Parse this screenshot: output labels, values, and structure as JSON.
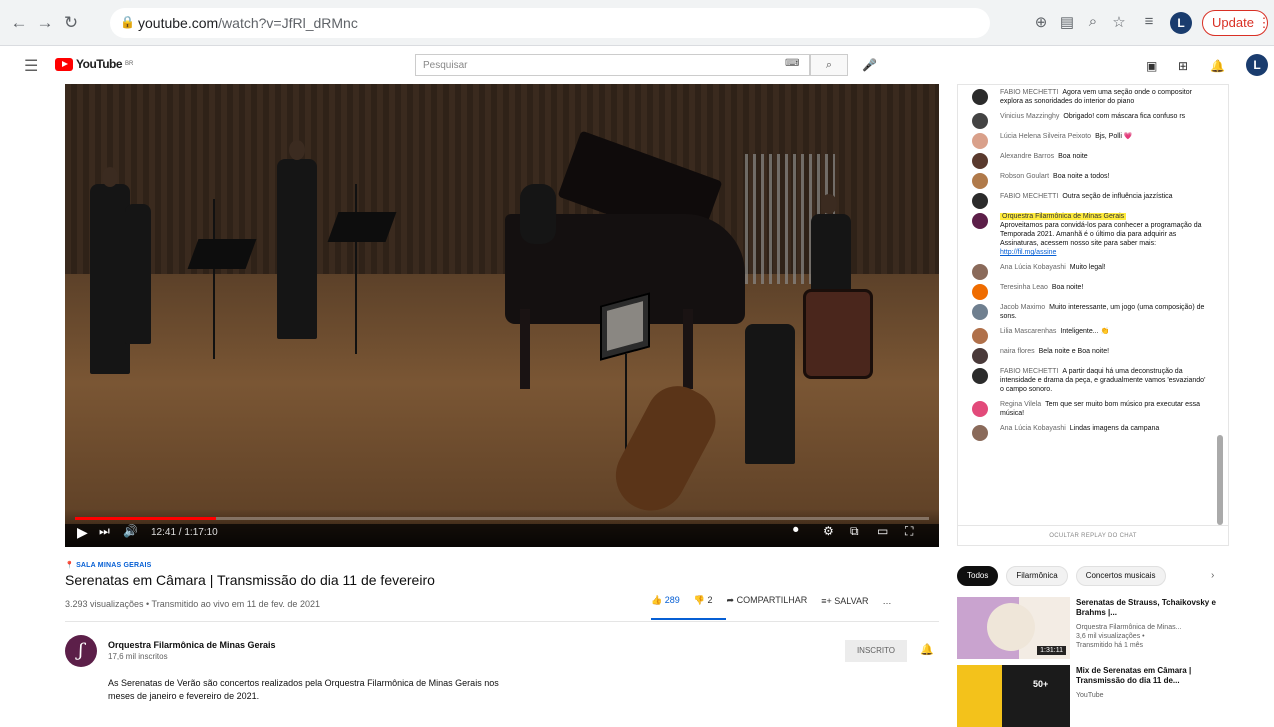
{
  "browser": {
    "url_host": "youtube.com",
    "url_path": "/watch?v=JfRl_dRMnc",
    "update_label": "Update",
    "profile_initial": "L"
  },
  "header": {
    "logo_text": "YouTube",
    "logo_country": "BR",
    "search_placeholder": "Pesquisar",
    "avatar_initial": "L"
  },
  "player": {
    "time": "12:41 / 1:17:10",
    "progress_fraction": 0.165
  },
  "video": {
    "location": "SALA MINAS GERAIS",
    "title": "Serenatas em Câmara | Transmissão do dia 11 de fevereiro",
    "meta": "3.293 visualizações • Transmitido ao vivo em 11 de fev. de 2021",
    "likes": "289",
    "dislikes": "2",
    "share_label": "COMPARTILHAR",
    "save_label": "SALVAR",
    "more": "…"
  },
  "channel": {
    "name": "Orquestra Filarmônica de Minas Gerais",
    "subscribers": "17,6 mil inscritos",
    "subscribed_label": "INSCRITO",
    "description_line1": "As Serenatas de Verão são concertos realizados pela Orquestra Filarmônica de Minas Gerais nos",
    "description_line2": "meses de janeiro e fevereiro de 2021."
  },
  "chat": {
    "messages": [
      {
        "author": "FABIO MECHETTI",
        "text": "Agora vem uma seção onde o compositor explora as sonoridades do interior do piano",
        "color": "#2b2b2b"
      },
      {
        "author": "Vinicius Mazzinghy",
        "text": "Obrigado! com máscara fica confuso rs",
        "color": "#444444"
      },
      {
        "author": "Lúcia Helena Silveira Peixoto",
        "text": "Bjs, Polli 💗",
        "color": "#d9a08a"
      },
      {
        "author": "Alexandre Barros",
        "text": "Boa noite",
        "color": "#5a3a2e"
      },
      {
        "author": "Robson Goulart",
        "text": "Boa noite a todos!",
        "color": "#b07a4a"
      },
      {
        "author": "FABIO MECHETTI",
        "text": "Outra seção de influência jazzística",
        "color": "#2b2b2b"
      },
      {
        "author": "Orquestra Filarmônica de Minas Gerais",
        "text": "Aproveitamos para convidá-los para conhecer a programação da Temporada 2021. Amanhã é o último dia para adquirir as Assinaturas, acessem nosso site para saber mais:",
        "link": "http://fil.mg/assine",
        "color": "#5c1f49",
        "pinned": true
      },
      {
        "author": "Ana Lúcia Kobayashi",
        "text": "Muito legal!",
        "color": "#8a6a5a"
      },
      {
        "author": "Teresinha Leao",
        "text": "Boa noite!",
        "color": "#ef6c00"
      },
      {
        "author": "Jacob Maximo",
        "text": "Muito interessante, um jogo (uma composição) de sons.",
        "color": "#6f7f8f"
      },
      {
        "author": "Lilia Mascarenhas",
        "text": "Inteligente... 👏",
        "color": "#b0704a"
      },
      {
        "author": "naira flores",
        "text": "Bela noite e Boa noite!",
        "color": "#4a3a3a"
      },
      {
        "author": "FABIO MECHETTI",
        "text": "A partir daqui há uma deconstrução da intensidade e drama da peça, e gradualmente vamos 'esvaziando' o campo sonoro.",
        "color": "#2b2b2b"
      },
      {
        "author": "Regina Vilela",
        "text": "Tem que ser muito bom músico pra executar essa música!",
        "color": "#e24a7a"
      },
      {
        "author": "Ana Lúcia Kobayashi",
        "text": "Lindas imagens da campana",
        "color": "#8a6a5a"
      }
    ],
    "footer": "OCULTAR REPLAY DO CHAT"
  },
  "chips": [
    "Todos",
    "Filarmônica",
    "Concertos musicais"
  ],
  "recommendations": [
    {
      "title": "Serenatas de Strauss, Tchaikovsky e Brahms |...",
      "channel": "Orquestra Filarmônica de Minas...",
      "views": "3,6 mil visualizações •",
      "when": "Transmitido há 1 mês",
      "duration": "1:31:11"
    },
    {
      "title": "Mix de Serenatas em Câmara | Transmissão do dia 11 de...",
      "channel": "YouTube",
      "views": "",
      "when": "",
      "duration": "50+"
    }
  ]
}
